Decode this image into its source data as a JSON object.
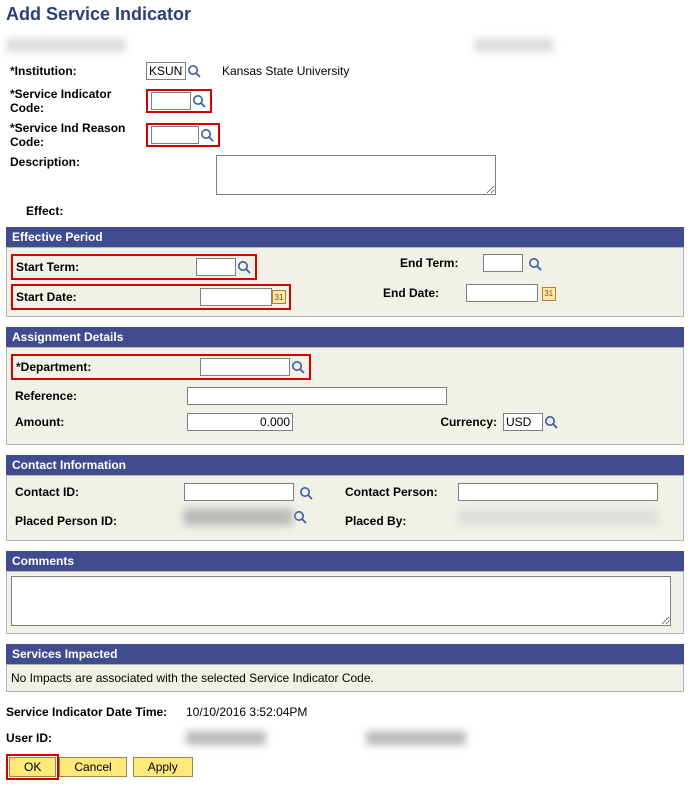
{
  "page": {
    "title": "Add Service Indicator"
  },
  "institution": {
    "label": "*Institution:",
    "value": "KSUNV",
    "display": "Kansas State University"
  },
  "svc_code": {
    "label": "*Service Indicator Code:",
    "value": ""
  },
  "svc_reason": {
    "label": "*Service Ind Reason Code:",
    "value": ""
  },
  "description": {
    "label": "Description:",
    "value": ""
  },
  "effect": {
    "label": "Effect:"
  },
  "effective_period": {
    "title": "Effective Period",
    "start_term": {
      "label": "Start Term:",
      "value": ""
    },
    "end_term": {
      "label": "End Term:",
      "value": ""
    },
    "start_date": {
      "label": "Start Date:",
      "value": ""
    },
    "end_date": {
      "label": "End Date:",
      "value": ""
    }
  },
  "assignment": {
    "title": "Assignment Details",
    "department": {
      "label": "*Department:",
      "value": ""
    },
    "reference": {
      "label": "Reference:",
      "value": ""
    },
    "amount": {
      "label": "Amount:",
      "value": "0.000"
    },
    "currency": {
      "label": "Currency:",
      "value": "USD"
    }
  },
  "contact": {
    "title": "Contact Information",
    "contact_id": {
      "label": "Contact ID:",
      "value": ""
    },
    "contact_person": {
      "label": "Contact Person:",
      "value": ""
    },
    "placed_id": {
      "label": "Placed Person ID:",
      "value": ""
    },
    "placed_by": {
      "label": "Placed By:",
      "value": ""
    }
  },
  "comments": {
    "title": "Comments",
    "value": ""
  },
  "services_impacted": {
    "title": "Services Impacted",
    "msg": "No Impacts are associated with the selected Service Indicator Code."
  },
  "footer": {
    "dt_label": "Service Indicator Date Time:",
    "dt_value": "10/10/2016  3:52:04PM",
    "userid_label": "User ID:"
  },
  "buttons": {
    "ok": "OK",
    "cancel": "Cancel",
    "apply": "Apply"
  },
  "calendar_glyph": "31"
}
